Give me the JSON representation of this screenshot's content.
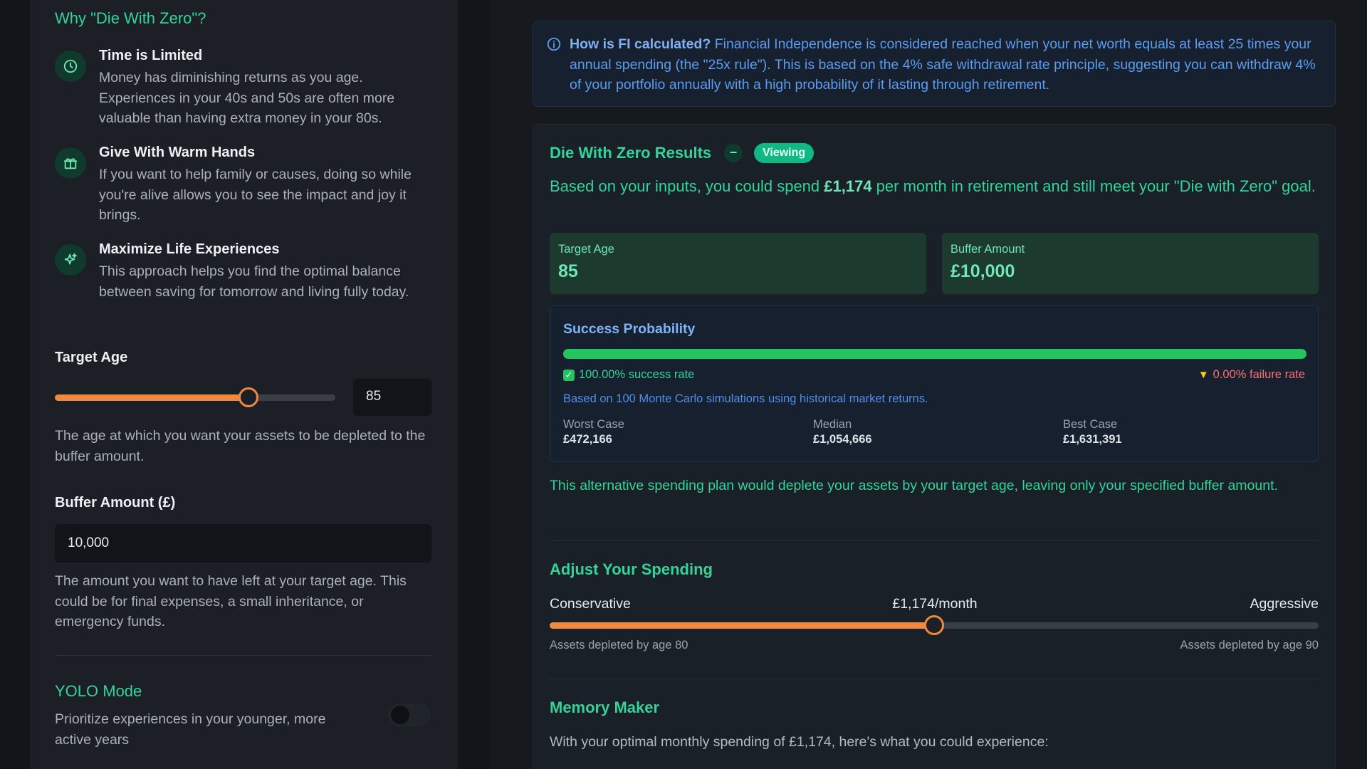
{
  "colors": {
    "accent_green": "#34d399",
    "accent_orange": "#f0883e",
    "info_blue": "#5b9cf0",
    "failure_red": "#f87171"
  },
  "sidebar": {
    "why_title": "Why \"Die With Zero\"?",
    "benefits": [
      {
        "icon": "clock-icon",
        "title": "Time is Limited",
        "text": "Money has diminishing returns as you age. Experiences in your 40s and 50s are often more valuable than having extra money in your 80s."
      },
      {
        "icon": "gift-icon",
        "title": "Give With Warm Hands",
        "text": "If you want to help family or causes, doing so while you're alive allows you to see the impact and joy it brings."
      },
      {
        "icon": "sparkles-icon",
        "title": "Maximize Life Experiences",
        "text": "This approach helps you find the optimal balance between saving for tomorrow and living fully today."
      }
    ],
    "target_age": {
      "label": "Target Age",
      "value": "85",
      "slider_fraction": 0.69,
      "help": "The age at which you want your assets to be depleted to the buffer amount."
    },
    "buffer": {
      "label": "Buffer Amount (£)",
      "value": "10,000",
      "help": "The amount you want to have left at your target age. This could be for final expenses, a small inheritance, or emergency funds."
    },
    "yolo": {
      "title": "YOLO Mode",
      "text": "Prioritize experiences in your younger, more active years",
      "enabled": false
    }
  },
  "info": {
    "bold": "How is FI calculated?",
    "text": " Financial Independence is considered reached when your net worth equals at least 25 times your annual spending (the \"25x rule\"). This is based on the 4% safe withdrawal rate principle, suggesting you can withdraw 4% of your portfolio annually with a high probability of it lasting through retirement."
  },
  "results": {
    "title": "Die With Zero Results",
    "collapse_symbol": "−",
    "badge": "Viewing",
    "summary_pre": "Based on your inputs, you could spend ",
    "summary_amount": "£1,174",
    "summary_post": " per month in retirement and still meet your \"Die with Zero\" goal.",
    "target_age_label": "Target Age",
    "target_age_value": "85",
    "buffer_label": "Buffer Amount",
    "buffer_value": "£10,000",
    "probability": {
      "title": "Success Probability",
      "success_fraction": 1.0,
      "success_text": "100.00% success rate",
      "failure_text": "0.00% failure rate",
      "note": "Based on 100 Monte Carlo simulations using historical market returns.",
      "worst_label": "Worst Case",
      "worst_value": "£472,166",
      "median_label": "Median",
      "median_value": "£1,054,666",
      "best_label": "Best Case",
      "best_value": "£1,631,391"
    },
    "alt_note": "This alternative spending plan would deplete your assets by your target age, leaving only your specified buffer amount.",
    "adjust": {
      "title": "Adjust Your Spending",
      "left_label": "Conservative",
      "current": "£1,174/month",
      "right_label": "Aggressive",
      "slider_fraction": 0.5,
      "left_sub": "Assets depleted by age 80",
      "right_sub": "Assets depleted by age 90"
    },
    "memory": {
      "title": "Memory Maker",
      "text": "With your optimal monthly spending of £1,174, here's what you could experience:"
    }
  }
}
